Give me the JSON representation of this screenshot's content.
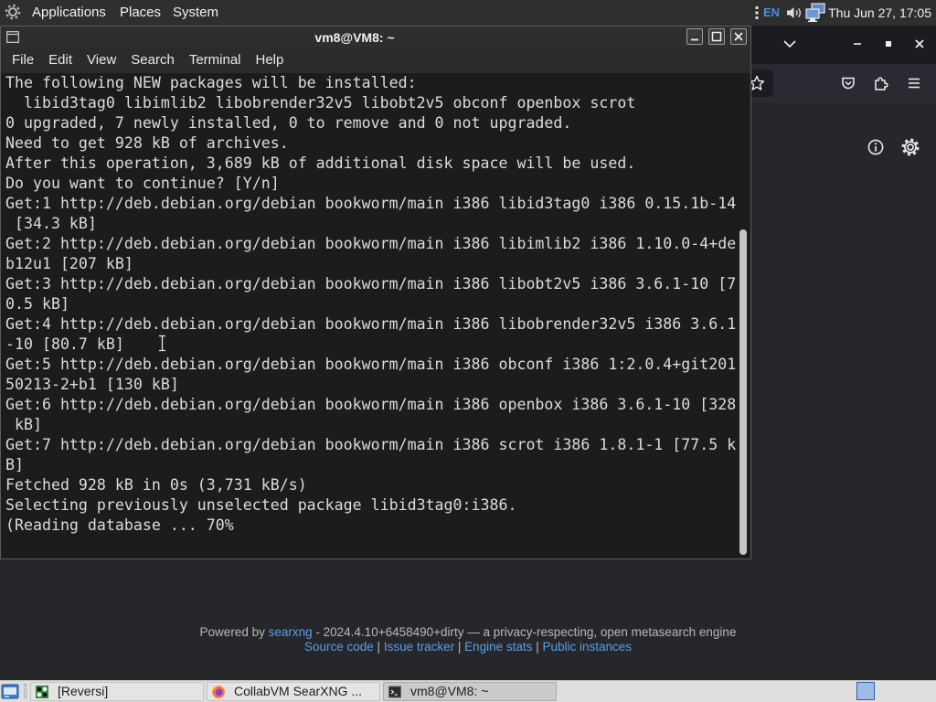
{
  "top_panel": {
    "menus": {
      "applications": "Applications",
      "places": "Places",
      "system": "System"
    },
    "keyboard_layout": "EN",
    "clock": "Thu Jun 27, 17:05"
  },
  "terminal": {
    "title": "vm8@VM8: ~",
    "menu": [
      "File",
      "Edit",
      "View",
      "Search",
      "Terminal",
      "Help"
    ],
    "lines": [
      "The following NEW packages will be installed:",
      "  libid3tag0 libimlib2 libobrender32v5 libobt2v5 obconf openbox scrot",
      "0 upgraded, 7 newly installed, 0 to remove and 0 not upgraded.",
      "Need to get 928 kB of archives.",
      "After this operation, 3,689 kB of additional disk space will be used.",
      "Do you want to continue? [Y/n]",
      "Get:1 http://deb.debian.org/debian bookworm/main i386 libid3tag0 i386 0.15.1b-14",
      " [34.3 kB]",
      "Get:2 http://deb.debian.org/debian bookworm/main i386 libimlib2 i386 1.10.0-4+de",
      "b12u1 [207 kB]",
      "Get:3 http://deb.debian.org/debian bookworm/main i386 libobt2v5 i386 3.6.1-10 [7",
      "0.5 kB]",
      "Get:4 http://deb.debian.org/debian bookworm/main i386 libobrender32v5 i386 3.6.1",
      "-10 [80.7 kB]",
      "Get:5 http://deb.debian.org/debian bookworm/main i386 obconf i386 1:2.0.4+git201",
      "50213-2+b1 [130 kB]",
      "Get:6 http://deb.debian.org/debian bookworm/main i386 openbox i386 3.6.1-10 [328",
      " kB]",
      "Get:7 http://deb.debian.org/debian bookworm/main i386 scrot i386 1.8.1-1 [77.5 k",
      "B]",
      "Fetched 928 kB in 0s (3,731 kB/s)",
      "Selecting previously unselected package libid3tag0:i386.",
      "(Reading database ... 70%"
    ]
  },
  "browser": {
    "footer": {
      "powered_prefix": "Powered by",
      "powered_link": "searxng",
      "powered_suffix": "- 2024.4.10+6458490+dirty — a privacy-respecting, open metasearch engine",
      "links": [
        "Source code",
        "Issue tracker",
        "Engine stats",
        "Public instances"
      ],
      "separator": "|"
    }
  },
  "taskbar": {
    "items": [
      {
        "label": "[Reversi]",
        "icon": "reversi-icon"
      },
      {
        "label": "CollabVM SearXNG ...",
        "icon": "firefox-icon"
      },
      {
        "label": "vm8@VM8: ~",
        "icon": "terminal-icon"
      }
    ]
  },
  "icons": [
    "system-logo-icon",
    "indicator-dots-icon",
    "speaker-icon",
    "network-icon",
    "terminal-window-icon",
    "minimize-icon",
    "maximize-icon",
    "close-icon",
    "chevron-down-icon",
    "bookmark-star-icon",
    "pocket-icon",
    "extensions-icon",
    "hamburger-menu-icon",
    "info-icon",
    "gear-icon",
    "show-desktop-icon",
    "reversi-icon",
    "firefox-icon",
    "terminal-icon",
    "workspace-icon",
    "mouse-ibeam-icon"
  ],
  "colors": {
    "top_panel_bg": "#2f2f2f",
    "keyboard_layout": "#4a90d9",
    "terminal_bg": "#1c1c1c",
    "terminal_text": "#dcdcdc",
    "browser_titlebar": "#1c1b22",
    "browser_toolbar": "#2b2a33",
    "browser_content": "#26272b",
    "link": "#5b9ee6",
    "taskbar_bg": "#dedede"
  }
}
